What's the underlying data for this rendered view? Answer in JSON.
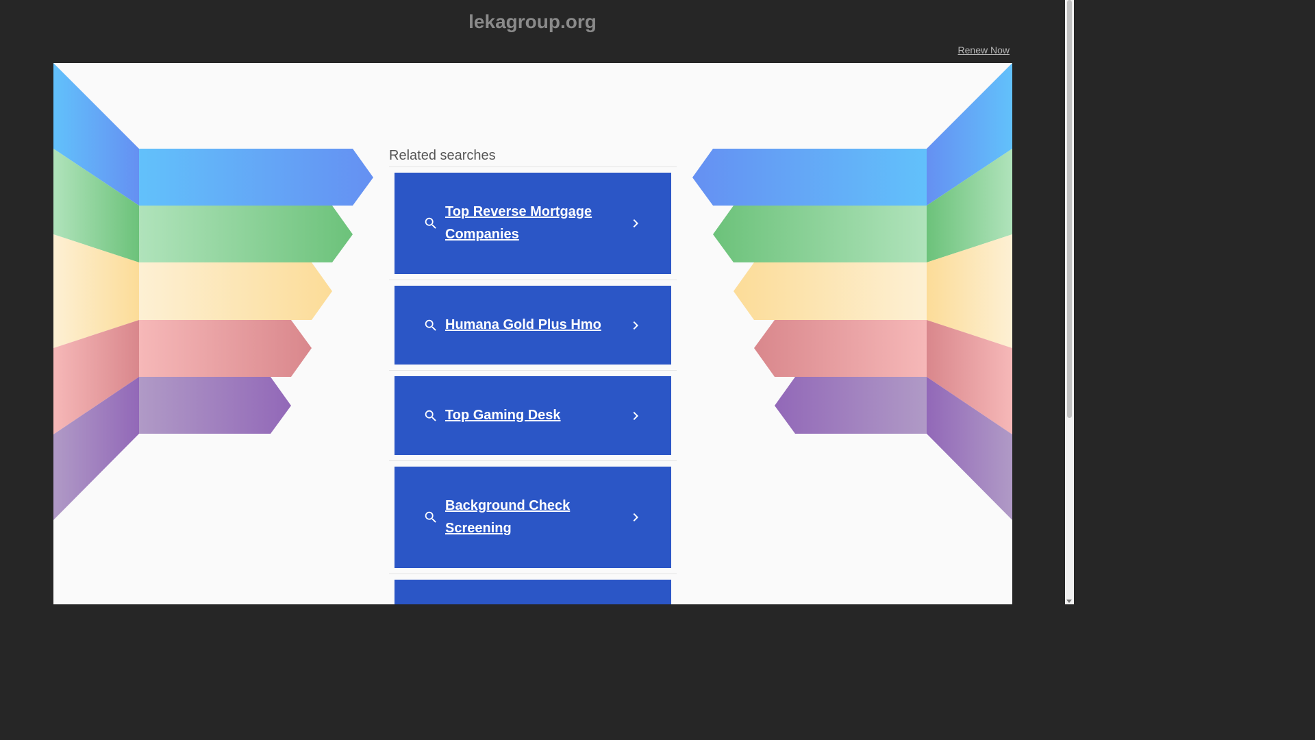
{
  "header": {
    "domain": "lekagroup.org",
    "renew_label": "Renew Now"
  },
  "related": {
    "title": "Related searches",
    "items": [
      {
        "label": "Top Reverse Mortgage Companies"
      },
      {
        "label": "Humana Gold Plus Hmo"
      },
      {
        "label": "Top Gaming Desk"
      },
      {
        "label": "Background Check Screening"
      },
      {
        "label": ""
      }
    ]
  },
  "icons": {
    "search": "search-icon",
    "chevron": "chevron-right-icon"
  },
  "colors": {
    "page_background": "#262626",
    "content_background": "#fafafa",
    "card_background": "#2b56c6",
    "band_blue": "#5a9cf6",
    "band_green": "#82cc8a",
    "band_yellow": "#fcdca0",
    "band_red": "#e0a0a4",
    "band_purple": "#a68bc0"
  }
}
